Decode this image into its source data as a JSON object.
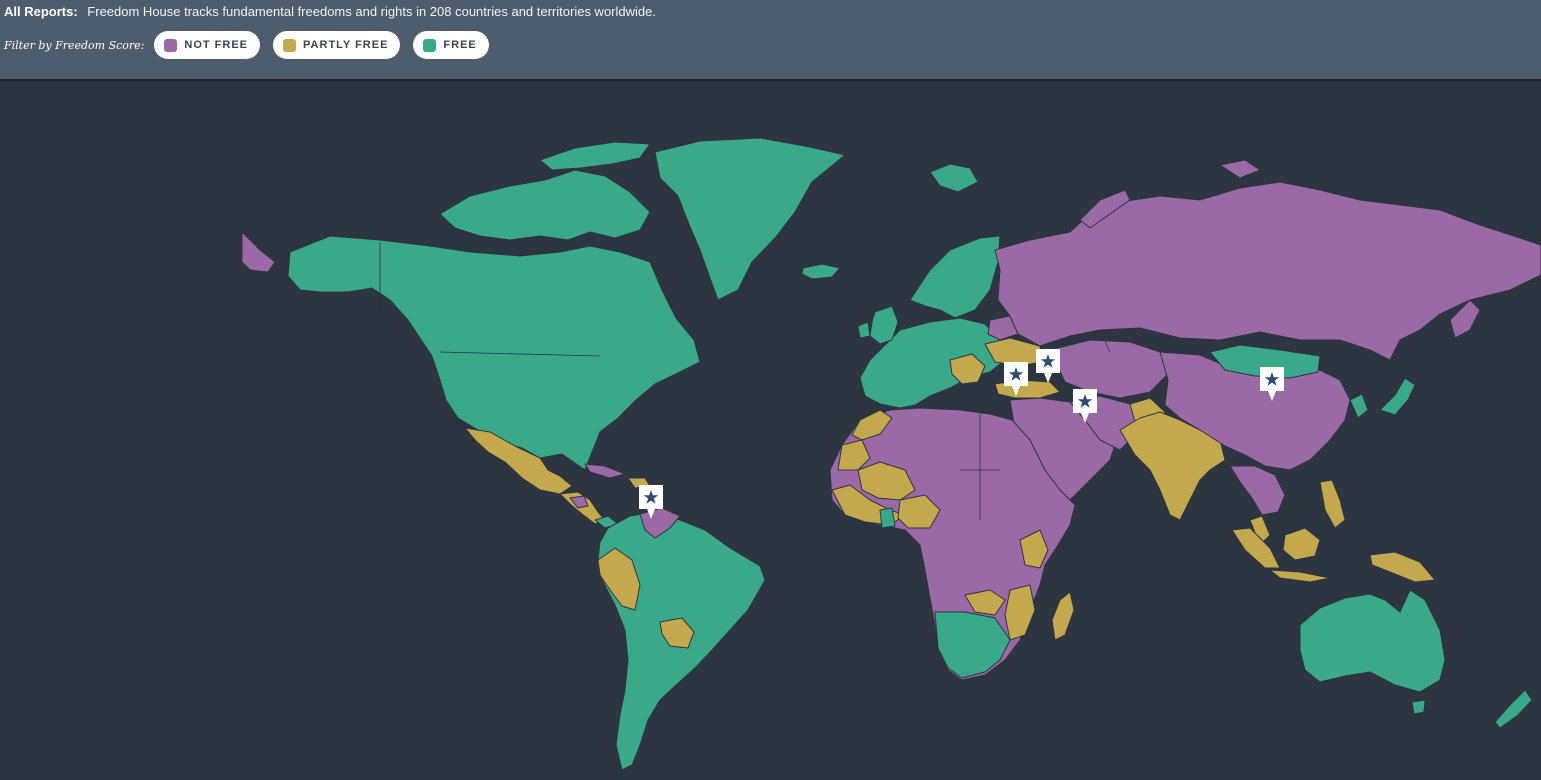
{
  "header": {
    "report_label": "All Reports:",
    "report_description": "Freedom House tracks fundamental freedoms and rights in 208 countries and territories worldwide.",
    "filter_label": "Filter by Freedom Score:",
    "filters": [
      {
        "label": "NOT FREE",
        "color": "#9b69a6"
      },
      {
        "label": "PARTLY FREE",
        "color": "#c4a84d"
      },
      {
        "label": "FREE",
        "color": "#3aa98a"
      }
    ]
  },
  "map": {
    "background_color": "#2d3540",
    "legend_colors": {
      "not_free": "#9b69a6",
      "partly_free": "#c4a84d",
      "free": "#3aa98a"
    },
    "marker_icon": "star-icon",
    "markers": [
      "venezuela-marker",
      "turkey-marker",
      "armenia-marker",
      "iran-marker",
      "china-marker"
    ]
  }
}
